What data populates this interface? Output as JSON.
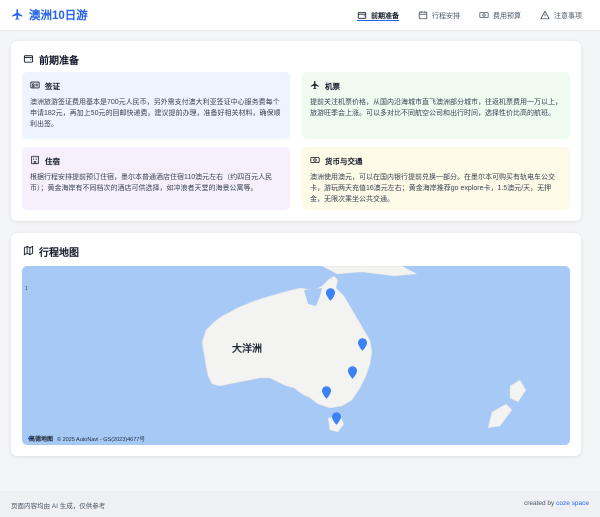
{
  "app": {
    "title": "澳洲10日游"
  },
  "nav": {
    "items": [
      {
        "label": "前期准备",
        "icon": "wallet-icon",
        "active": true
      },
      {
        "label": "行程安排",
        "icon": "calendar-icon",
        "active": false
      },
      {
        "label": "费用预算",
        "icon": "money-icon",
        "active": false
      },
      {
        "label": "注意事项",
        "icon": "warning-icon",
        "active": false
      }
    ]
  },
  "prep": {
    "title": "前期准备",
    "sections": [
      {
        "key": "visa",
        "title": "签证",
        "icon": "id-card-icon",
        "text": "澳洲旅游签证费用基本是700元人民币，另外需支付澳大利亚签证中心服务费每个申请182元，再加上50元的回邮快递费。建议提前办理，准备好相关材料，确保顺利出签。"
      },
      {
        "key": "flight",
        "title": "机票",
        "icon": "plane-icon",
        "text": "提前关注机票价格，从国内沿海城市直飞澳洲部分城市，往返机票费用一万以上，旅游旺季会上涨。可以多对比不同航空公司和出行时间，选择性价比高的航班。"
      },
      {
        "key": "hotel",
        "title": "住宿",
        "icon": "hotel-icon",
        "text": "根据行程安排提前预订住宿，墨尔本普通酒店住宿110澳元左右（约四百元人民币）；黄金海岸有不同档次的酒店可供选择，如冲浪者天堂的海景公寓等。"
      },
      {
        "key": "money",
        "title": "货币与交通",
        "icon": "currency-icon",
        "text": "澳洲使用澳元，可以在国内银行提前兑换一部分。在墨尔本可购买有轨电车公交卡，游玩两天充值16澳元左右；黄金海岸推荐go explore卡，1.5澳元/天，无押金，无限次乘坐公共交通。"
      }
    ]
  },
  "map_section": {
    "title": "行程地图",
    "map_label": "大洋洲",
    "scale_mark": "1",
    "credit_logo": "高德地图",
    "credit_text": "© 2025 AutoNavi - GS(2023)4677号",
    "pins": 5
  },
  "footer": {
    "left": "页面内容均由 AI 生成，仅供参考",
    "right_prefix": "created by ",
    "right_brand": "coze space"
  },
  "colors": {
    "accent": "#2563eb",
    "water": "#a7c9f5",
    "land": "#f3f3f1",
    "pin": "#3b82f6"
  }
}
